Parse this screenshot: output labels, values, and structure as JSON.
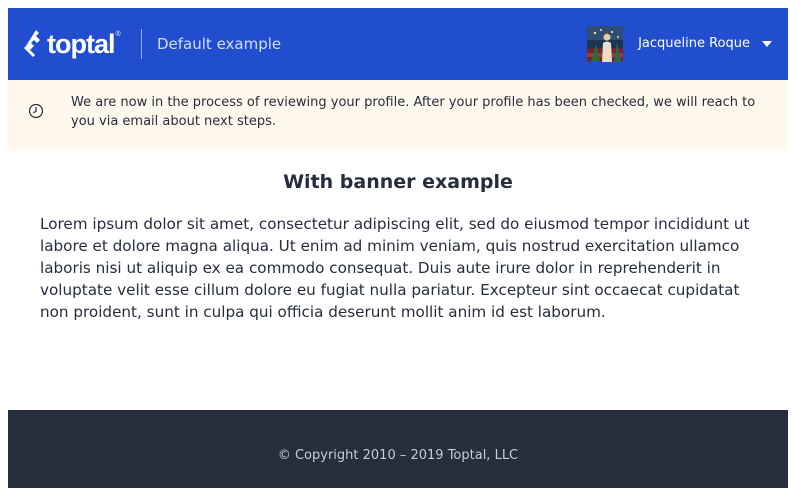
{
  "header": {
    "brand": "toptal",
    "brand_mark": "®",
    "app_title": "Default example",
    "user": {
      "name": "Jacqueline Roque",
      "avatar": "user-avatar-image"
    },
    "icons": {
      "logo": "toptal-logo-icon",
      "dropdown": "caret-down-icon"
    },
    "colors": {
      "background": "#204ecf"
    }
  },
  "banner": {
    "icon": "clock-icon",
    "text": "We are now in the process of reviewing your profile. After your profile has been checked, we will reach to you via email about next steps.",
    "colors": {
      "background": "#fff8ec"
    }
  },
  "main": {
    "title": "With banner example",
    "body": "Lorem ipsum dolor sit amet, consectetur adipiscing elit, sed do eiusmod tempor incididunt ut labore et dolore magna aliqua. Ut enim ad minim veniam, quis nostrud exercitation ullamco laboris nisi ut aliquip ex ea commodo consequat. Duis aute irure dolor in reprehenderit in voluptate velit esse cillum dolore eu fugiat nulla pariatur. Excepteur sint occaecat cupidatat non proident, sunt in culpa qui officia deserunt mollit anim id est laborum."
  },
  "footer": {
    "copyright": "© Copyright 2010 – 2019 Toptal, LLC",
    "colors": {
      "background": "#262d3d"
    }
  }
}
